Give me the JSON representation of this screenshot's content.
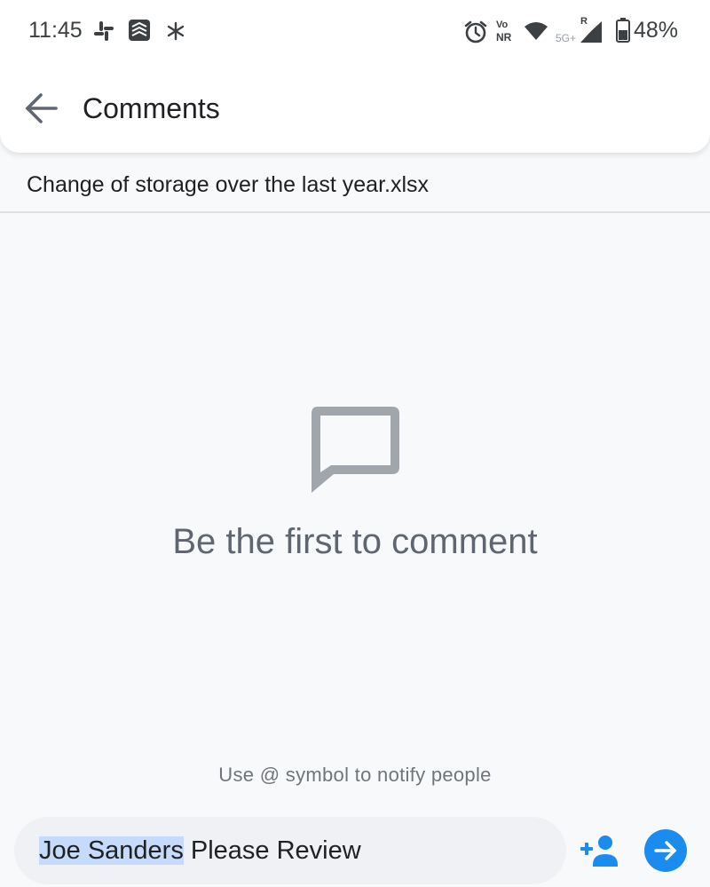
{
  "status_bar": {
    "time": "11:45",
    "icons": [
      "slack-icon",
      "todoist-icon",
      "asterisk-icon",
      "alarm-icon",
      "vonr-icon",
      "wifi-icon",
      "signal-5g-icon",
      "battery-icon"
    ],
    "vonr_top": "Vo",
    "vonr_bottom": "NR",
    "network": "5G+",
    "roaming": "R",
    "battery": "48%"
  },
  "header": {
    "title": "Comments"
  },
  "file": {
    "name": "Change of storage over the last year.xlsx"
  },
  "empty_state": {
    "message": "Be the first to comment"
  },
  "hint": "Use @ symbol to notify people",
  "composer": {
    "mention": "Joe Sanders",
    "text": " Please Review"
  },
  "colors": {
    "accent": "#1a8cf0",
    "mention_highlight": "#c6dafc",
    "icon_gray": "#a1a6ad"
  }
}
